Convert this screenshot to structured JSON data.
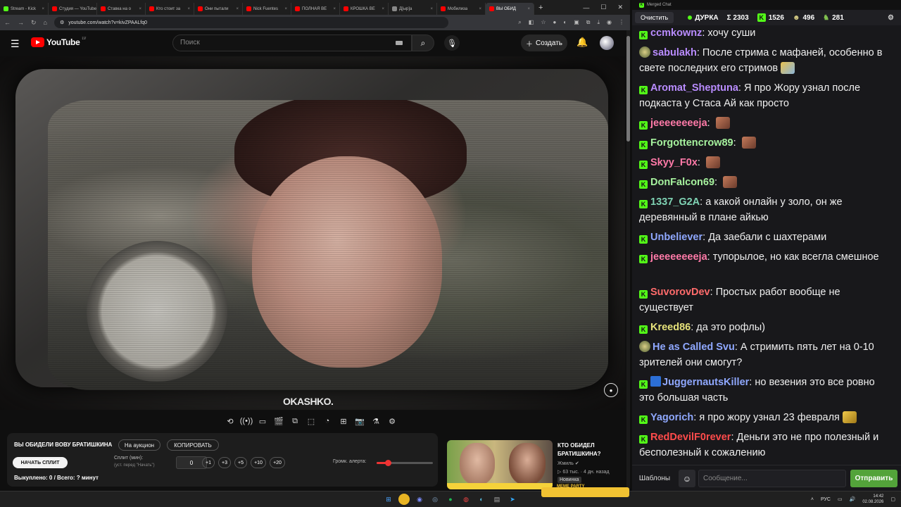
{
  "browser": {
    "tabs": [
      {
        "title": "Stream - Kick",
        "color": "#53fc18"
      },
      {
        "title": "Студия — YouTube",
        "color": "#ff0000"
      },
      {
        "title": "Ставка на о",
        "color": "#ff0000"
      },
      {
        "title": "Кто стоит за",
        "color": "#ff0000"
      },
      {
        "title": "Они пытали",
        "color": "#ff0000"
      },
      {
        "title": "Nick Fuentes",
        "color": "#ff0000"
      },
      {
        "title": "ПОЛНАЯ ВЕ",
        "color": "#ff0000"
      },
      {
        "title": "КРОШКА ВЕ",
        "color": "#ff0000"
      },
      {
        "title": "Д[ыр]а",
        "color": "#888888"
      },
      {
        "title": "Мобилиза",
        "color": "#ff0000"
      },
      {
        "title": "ВЫ ОБИД",
        "color": "#ff0000",
        "active": true
      }
    ],
    "url": "youtube.com/watch?v=kivZPAALfq0"
  },
  "youtube": {
    "logo_text": "YouTube",
    "region": "LV",
    "search_placeholder": "Поиск",
    "create_label": "Создать"
  },
  "video": {
    "watermark": "OKASHKO."
  },
  "auction_panel": {
    "title": "ВЫ ОБИДЕЛИ ВОВУ БРАТИШКИНА",
    "auction_btn": "На аукцион",
    "copy_btn": "КОПИРОВАТЬ",
    "start_split_btn": "НАЧАТЬ СПЛИТ",
    "split_label": "Сплит (мин):",
    "split_hint": "(уст. перед \"Начать\")",
    "split_value": "0",
    "increments": [
      "+1",
      "+3",
      "+5",
      "+10",
      "+20"
    ],
    "volume_label": "Громк. алерта:",
    "volume_level": 0.2,
    "bought_text": "Выкуплено: 0 / Всего: ? минут"
  },
  "recommendation": {
    "title": "КТО ОБИДЕЛ БРАТИШКИНА?",
    "channel": "Жмиль",
    "meta": "63 тыс. · 4 дн. назад",
    "badge": "Новинка",
    "pill_label": "MEME PARTY"
  },
  "chat": {
    "window_title": "Merged Chat",
    "clear_btn": "Очистить",
    "stats": {
      "streamer": "ДУРКА",
      "total": "Σ 2303",
      "kick": "1526",
      "twitch": "496",
      "youtube": "281"
    },
    "messages": [
      {
        "user": "ccmkownz",
        "color": "#b98cff",
        "text": "хочу суши",
        "badge": "kick"
      },
      {
        "user": "sabulakh",
        "color": "#b98cff",
        "text": "После стрима с мафаней, особенно в свете последних его стримов",
        "badge": "avatar",
        "emote": "face"
      },
      {
        "user": "Aromat_Sheptuna",
        "color": "#b98cff",
        "text": "Я про Жору узнал после подкаста у Стаса Ай как просто",
        "badge": "kick"
      },
      {
        "user": "jeeeeeeeeja",
        "color": "#ff7aa8",
        "text": "",
        "badge": "kick",
        "emote": "brown"
      },
      {
        "user": "Forgottencrow89",
        "color": "#a6f29e",
        "text": "",
        "badge": "kick",
        "emote": "brown"
      },
      {
        "user": "Skyy_F0x",
        "color": "#ff7aa8",
        "text": "",
        "badge": "kick",
        "emote": "brown"
      },
      {
        "user": "DonFalcon69",
        "color": "#a6f29e",
        "text": "",
        "badge": "kick",
        "emote": "brown"
      },
      {
        "user": "1337_G2A",
        "color": "#7fd3b4",
        "text": "а какой онлайн у золо, он же деревянный в плане айкью",
        "badge": "kick"
      },
      {
        "user": "Unbeliever",
        "color": "#8fa8ff",
        "text": "Да заебали с шахтерами",
        "badge": "kick"
      },
      {
        "user": "jeeeeeeeeja",
        "color": "#ff7aa8",
        "text": "тупорылое, но как всегла смешное",
        "badge": "kick"
      },
      {
        "user": "SuvorovDev",
        "color": "#ff6b6b",
        "text": "Простых работ вообще не существует",
        "badge": "kick"
      },
      {
        "user": "Kreed86",
        "color": "#e6e27a",
        "text": "да это рофлы)",
        "badge": "kick"
      },
      {
        "user": "He as Called Svu",
        "color": "#8fa8ff",
        "text": "А стримить пять лет на 0-10 зрителей они смогут?",
        "badge": "avatar"
      },
      {
        "user": "JuggernautsKiller",
        "color": "#8fa8ff",
        "text": "но везения это все ровно это большая часть",
        "badge": "kick_blue"
      },
      {
        "user": "Yagorich",
        "color": "#8fa8ff",
        "text": "я про жору узнал 23 февраля",
        "badge": "kick",
        "emote": "gold"
      },
      {
        "user": "RedDevilF0rever",
        "color": "#ff4b4b",
        "text": "Деньги это не про полезный и бесполезный к сожалению",
        "badge": "kick"
      }
    ],
    "templates_btn": "Шаблоны",
    "input_placeholder": "Сообщение...",
    "send_btn": "Отправить"
  },
  "taskbar": {
    "lang": "РУС",
    "time": "14:42",
    "date": "02.08.2026"
  }
}
